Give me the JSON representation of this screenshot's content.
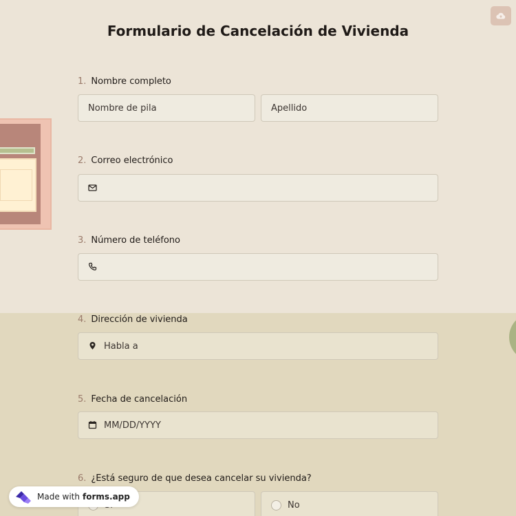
{
  "form": {
    "title": "Formulario de Cancelación de Vivienda",
    "questions": [
      {
        "number": "1.",
        "label": "Nombre completo",
        "fields": [
          {
            "placeholder": "Nombre de pila"
          },
          {
            "placeholder": "Apellido"
          }
        ]
      },
      {
        "number": "2.",
        "label": "Correo electrónico",
        "icon": "mail-icon",
        "placeholder": ""
      },
      {
        "number": "3.",
        "label": "Número de teléfono",
        "icon": "phone-icon",
        "placeholder": ""
      },
      {
        "number": "4.",
        "label": "Dirección de vivienda",
        "icon": "map-pin-icon",
        "placeholder": "Habla a"
      },
      {
        "number": "5.",
        "label": "Fecha de cancelación",
        "icon": "calendar-icon",
        "placeholder": "MM/DD/YYYY"
      },
      {
        "number": "6.",
        "label": "¿Está seguro de que desea cancelar su vivienda?",
        "options": [
          "Sí",
          "No"
        ]
      }
    ]
  },
  "toolbar": {
    "upload_icon": "cloud-upload-icon"
  },
  "badge": {
    "prefix": "Made with",
    "brand": "forms.app"
  },
  "colors": {
    "background_top": "#ece4d7",
    "background_bottom": "#e1d8be",
    "field_bg": "#efebe0",
    "accent": "#dcc3b4"
  }
}
